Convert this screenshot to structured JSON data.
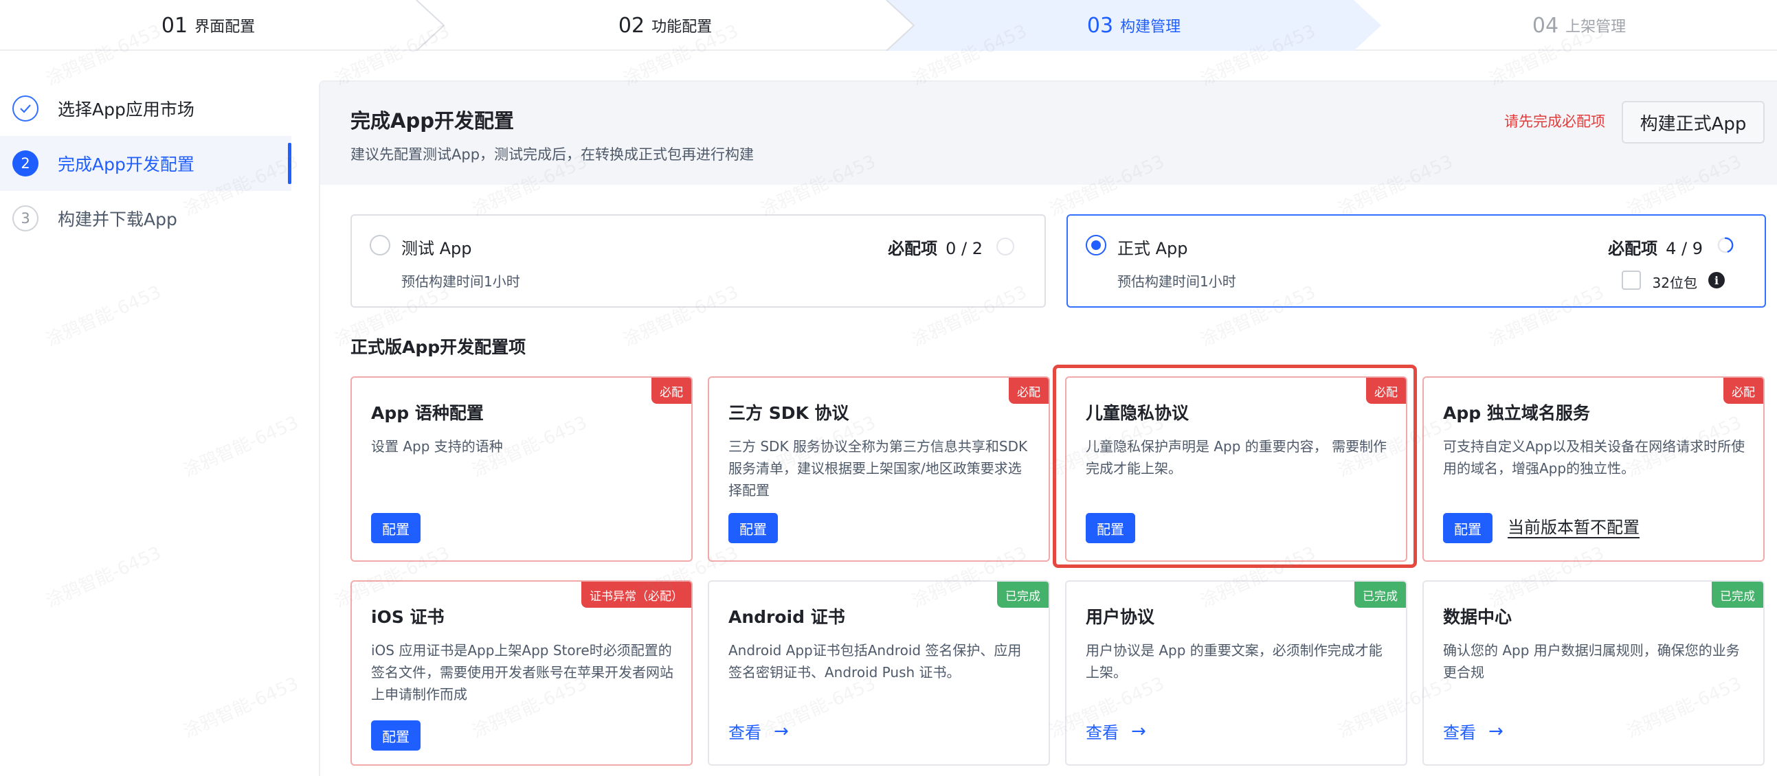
{
  "stepper": {
    "steps": [
      {
        "num": "01",
        "label": "界面配置"
      },
      {
        "num": "02",
        "label": "功能配置"
      },
      {
        "num": "03",
        "label": "构建管理"
      },
      {
        "num": "04",
        "label": "上架管理"
      }
    ],
    "active_index": 2,
    "colors": {
      "active_bg": "#eaf1ff",
      "active_text": "#1f5fff",
      "todo_text": "#a0a4ab"
    }
  },
  "nav": {
    "items": [
      {
        "icon": "check",
        "label": "选择App应用市场",
        "state": "done"
      },
      {
        "icon": "2",
        "label": "完成App开发配置",
        "state": "active"
      },
      {
        "icon": "3",
        "label": "构建并下载App",
        "state": "todo"
      }
    ]
  },
  "header": {
    "title": "完成App开发配置",
    "subtitle": "建议先配置测试App，测试完成后，在转换成正式包再进行构建",
    "warning": "请先完成必配项",
    "build_button": "构建正式App"
  },
  "modes": {
    "test": {
      "name": "测试 App",
      "time": "预估构建时间1小时",
      "req_label": "必配项",
      "req_count": "0 / 2",
      "selected": false,
      "progress": 0
    },
    "prod": {
      "name": "正式 App",
      "time": "预估构建时间1小时",
      "req_label": "必配项",
      "req_count": "4 / 9",
      "selected": true,
      "progress": 0.44,
      "checkbox_label": "32位包",
      "checkbox_checked": false,
      "info_icon": "i"
    }
  },
  "section_title": "正式版App开发配置项",
  "cards": [
    {
      "title": "App 语种配置",
      "desc": "设置 App 支持的语种",
      "tag": "必配",
      "tag_color": "red",
      "button": "配置"
    },
    {
      "title": "三方 SDK 协议",
      "desc": "三方 SDK 服务协议全称为第三方信息共享和SDK 服务清单，建议根据要上架国家/地区政策要求选择配置",
      "tag": "必配",
      "tag_color": "red",
      "button": "配置"
    },
    {
      "title": "儿童隐私协议",
      "desc": "儿童隐私保护声明是 App 的重要内容， 需要制作完成才能上架。",
      "tag": "必配",
      "tag_color": "red",
      "button": "配置",
      "highlighted": true
    },
    {
      "title": "App 独立域名服务",
      "desc": "可支持自定义App以及相关设备在网络请求时所使用的域名，增强App的独立性。",
      "tag": "必配",
      "tag_color": "red",
      "button": "配置",
      "link": "当前版本暂不配置"
    },
    {
      "title": "iOS 证书",
      "desc": "iOS 应用证书是App上架App Store时必须配置的签名文件，需要使用开发者账号在苹果开发者网站上申请制作而成",
      "tag": "证书异常（必配）",
      "tag_color": "red",
      "button": "配置"
    },
    {
      "title": "Android 证书",
      "desc": "Android App证书包括Android 签名保护、应用签名密钥证书、Android Push 证书。",
      "tag": "已完成",
      "tag_color": "green",
      "view": "查看"
    },
    {
      "title": "用户协议",
      "desc": "用户协议是 App 的重要文案，必须制作完成才能上架。",
      "tag": "已完成",
      "tag_color": "green",
      "view": "查看"
    },
    {
      "title": "数据中心",
      "desc": "确认您的 App 用户数据归属规则，确保您的业务更合规",
      "tag": "已完成",
      "tag_color": "green",
      "view": "查看"
    }
  ],
  "watermark": "涂鸦智能-6453"
}
